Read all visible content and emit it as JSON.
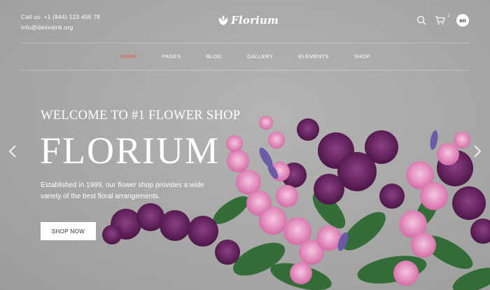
{
  "header": {
    "phone": "Call us: +1 (844) 123 456 78",
    "email": "info@demolink.org",
    "logo_text": "Florium",
    "cart_count": "2",
    "language": "en"
  },
  "nav": {
    "items": [
      {
        "label": "HOME",
        "active": true
      },
      {
        "label": "PAGES",
        "active": false
      },
      {
        "label": "BLOG",
        "active": false
      },
      {
        "label": "GALLERY",
        "active": false
      },
      {
        "label": "ELEMENTS",
        "active": false
      },
      {
        "label": "SHOP",
        "active": false
      }
    ]
  },
  "hero": {
    "welcome": "WELCOME TO #1 FLOWER SHOP",
    "title": "FLORIUM",
    "description": "Established in 1999, our flower shop provides a wide variety of the best floral arrangements.",
    "cta_label": "SHOP NOW"
  },
  "icons": {
    "search": "search-icon",
    "cart": "cart-icon",
    "logo": "tulip-logo-icon",
    "prev": "chevron-left-icon",
    "next": "chevron-right-icon"
  },
  "colors": {
    "active_nav": "#e8534a",
    "background": "#a9a9a7",
    "button_bg": "#ffffff"
  }
}
